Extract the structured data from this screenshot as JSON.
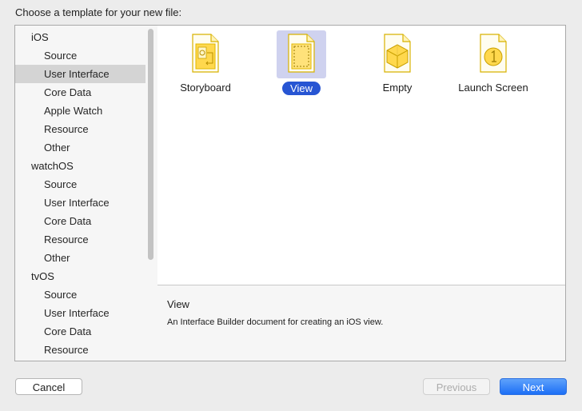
{
  "dialog": {
    "title": "Choose a template for your new file:"
  },
  "sidebar": {
    "groups": [
      {
        "platform": "iOS",
        "items": [
          "Source",
          "User Interface",
          "Core Data",
          "Apple Watch",
          "Resource",
          "Other"
        ]
      },
      {
        "platform": "watchOS",
        "items": [
          "Source",
          "User Interface",
          "Core Data",
          "Resource",
          "Other"
        ]
      },
      {
        "platform": "tvOS",
        "items": [
          "Source",
          "User Interface",
          "Core Data",
          "Resource"
        ]
      }
    ],
    "selected": "User Interface"
  },
  "templates": [
    {
      "label": "Storyboard",
      "icon": "storyboard-icon"
    },
    {
      "label": "View",
      "icon": "view-icon",
      "selected": true
    },
    {
      "label": "Empty",
      "icon": "empty-icon"
    },
    {
      "label": "Launch Screen",
      "icon": "launch-screen-icon"
    }
  ],
  "description": {
    "title": "View",
    "text": "An Interface Builder document for creating an iOS view."
  },
  "buttons": {
    "cancel": "Cancel",
    "previous": "Previous",
    "next": "Next"
  },
  "colors": {
    "accent": "#2755d3",
    "icon_fill": "#ffd84d",
    "icon_stroke": "#e0b700"
  }
}
